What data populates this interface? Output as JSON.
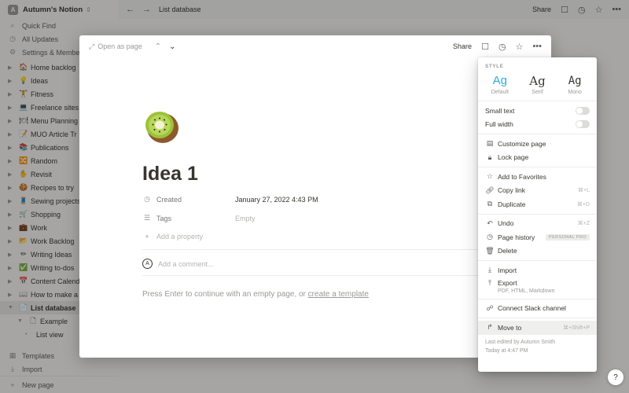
{
  "workspace": {
    "name": "Autumn's Notion",
    "avatar": "A"
  },
  "sidebar": {
    "nav": [
      {
        "icon": "⌕",
        "label": "Quick Find"
      },
      {
        "icon": "◷",
        "label": "All Updates"
      },
      {
        "icon": "⚙",
        "label": "Settings & Members"
      }
    ],
    "pages": [
      {
        "emoji": "🏠",
        "label": "Home backlog"
      },
      {
        "emoji": "💡",
        "label": "Ideas"
      },
      {
        "emoji": "🏋",
        "label": "Fitness"
      },
      {
        "emoji": "💻",
        "label": "Freelance sites"
      },
      {
        "emoji": "🍽",
        "label": "Menu Planning"
      },
      {
        "emoji": "📝",
        "label": "MUO Article Tr"
      },
      {
        "emoji": "📚",
        "label": "Publications"
      },
      {
        "emoji": "🔀",
        "label": "Random"
      },
      {
        "emoji": "✋",
        "label": "Revisit"
      },
      {
        "emoji": "🍪",
        "label": "Recipes to try"
      },
      {
        "emoji": "🧵",
        "label": "Sewing projects"
      },
      {
        "emoji": "🛒",
        "label": "Shopping"
      },
      {
        "emoji": "💼",
        "label": "Work"
      },
      {
        "emoji": "📂",
        "label": "Work Backlog"
      },
      {
        "emoji": "✏",
        "label": "Writing Ideas"
      },
      {
        "emoji": "✅",
        "label": "Writing to-dos"
      },
      {
        "emoji": "📅",
        "label": "Content Calendar"
      },
      {
        "emoji": "📖",
        "label": "How to make a"
      },
      {
        "emoji": "📄",
        "label": "List database"
      }
    ],
    "subpage": "Example",
    "subview": "List view",
    "bottom": [
      {
        "icon": "▦",
        "label": "Templates"
      },
      {
        "icon": "⤓",
        "label": "Import"
      },
      {
        "icon": "+",
        "label": "New page"
      }
    ]
  },
  "topbar": {
    "breadcrumb": "List database",
    "share": "Share"
  },
  "modal": {
    "open_as_page": "Open as page",
    "share": "Share",
    "title": "Idea 1",
    "properties": [
      {
        "icon": "◷",
        "label": "Created",
        "value": "January 27, 2022 4:43 PM"
      },
      {
        "icon": "☰",
        "label": "Tags",
        "value": "Empty"
      }
    ],
    "add_property": "Add a property",
    "comment_placeholder": "Add a comment...",
    "comment_avatar": "A",
    "hint_text": "Press Enter to continue with an empty page, or ",
    "hint_link": "create a template"
  },
  "menu": {
    "style_label": "STYLE",
    "styles": [
      {
        "glyph": "Ag",
        "name": "Default"
      },
      {
        "glyph": "Ag",
        "name": "Serif"
      },
      {
        "glyph": "Ag",
        "name": "Mono"
      }
    ],
    "small_text": "Small text",
    "full_width": "Full width",
    "customize_page": "Customize page",
    "lock_page": "Lock page",
    "add_to_favorites": "Add to Favorites",
    "copy_link": "Copy link",
    "copy_link_sc": "⌘+L",
    "duplicate": "Duplicate",
    "duplicate_sc": "⌘+D",
    "undo": "Undo",
    "undo_sc": "⌘+Z",
    "page_history": "Page history",
    "page_history_badge": "PERSONAL PRO",
    "delete": "Delete",
    "import": "Import",
    "export": "Export",
    "export_sub": "PDF, HTML, Markdown",
    "connect_slack": "Connect Slack channel",
    "move_to": "Move to",
    "move_to_sc": "⌘+Shift+P",
    "last_edited": "Last edited by Autumn Smith",
    "last_edited_time": "Today at 4:47 PM"
  },
  "help": "?",
  "colors": {
    "accent": "#2eaadc",
    "text": "#37352f",
    "muted": "#9b9a97"
  }
}
